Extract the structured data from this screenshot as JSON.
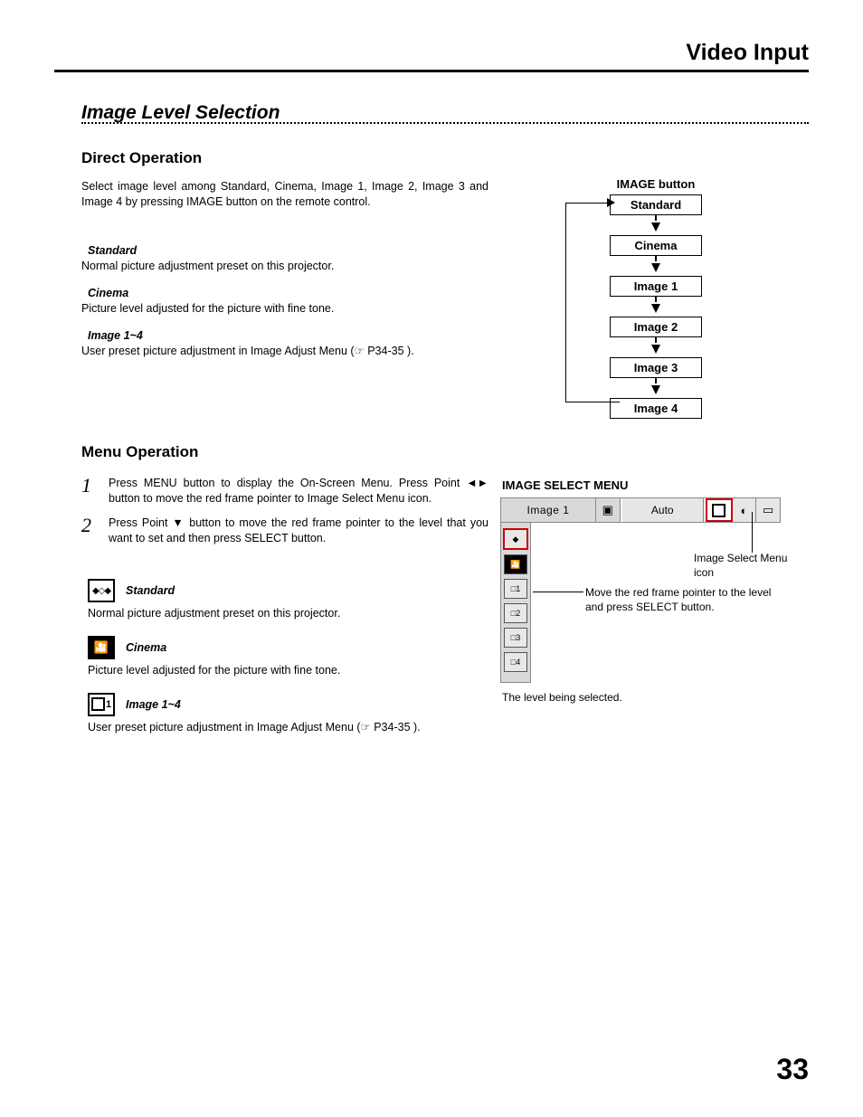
{
  "header": {
    "title": "Video Input"
  },
  "section": {
    "title": "Image Level Selection"
  },
  "direct": {
    "heading": "Direct Operation",
    "intro": "Select image level among Standard, Cinema, Image 1, Image 2, Image 3 and Image 4 by pressing IMAGE button on the remote control.",
    "defs": [
      {
        "title": "Standard",
        "desc": "Normal picture adjustment preset on this projector."
      },
      {
        "title": "Cinema",
        "desc": "Picture level adjusted for the picture with fine tone."
      },
      {
        "title": "Image 1~4",
        "desc": "User preset picture adjustment in Image Adjust Menu (☞ P34-35 )."
      }
    ]
  },
  "flowchart": {
    "caption": "IMAGE button",
    "items": [
      "Standard",
      "Cinema",
      "Image 1",
      "Image 2",
      "Image 3",
      "Image 4"
    ]
  },
  "menu": {
    "heading": "Menu Operation",
    "steps": [
      "Press MENU button to display the On-Screen Menu.  Press Point ◄► button to move the red frame pointer to Image Select Menu icon.",
      "Press Point ▼ button to move the red frame pointer to the level that you want to set and then press SELECT button."
    ],
    "defs": [
      {
        "icon": "standard-icon",
        "glyph": "◆◇◆",
        "title": "Standard",
        "desc": "Normal picture adjustment preset on this projector."
      },
      {
        "icon": "cinema-icon",
        "glyph": "🎦",
        "title": "Cinema",
        "desc": "Picture level adjusted for the picture with fine tone."
      },
      {
        "icon": "image1-icon",
        "glyph": "□1",
        "title": "Image 1~4",
        "desc": "User preset picture adjustment in Image Adjust Menu (☞ P34-35 )."
      }
    ]
  },
  "ism": {
    "title": "IMAGE SELECT MENU",
    "bar": {
      "current": "Image 1",
      "mode": "Auto"
    },
    "side_items": [
      "◆",
      "🎦",
      "□1",
      "□2",
      "□3",
      "□4"
    ],
    "callouts": {
      "icon_label": "Image Select Menu icon",
      "pointer_label": "Move the red frame pointer to the level and press SELECT button."
    },
    "caption_below": "The level being selected."
  },
  "page_number": "33"
}
